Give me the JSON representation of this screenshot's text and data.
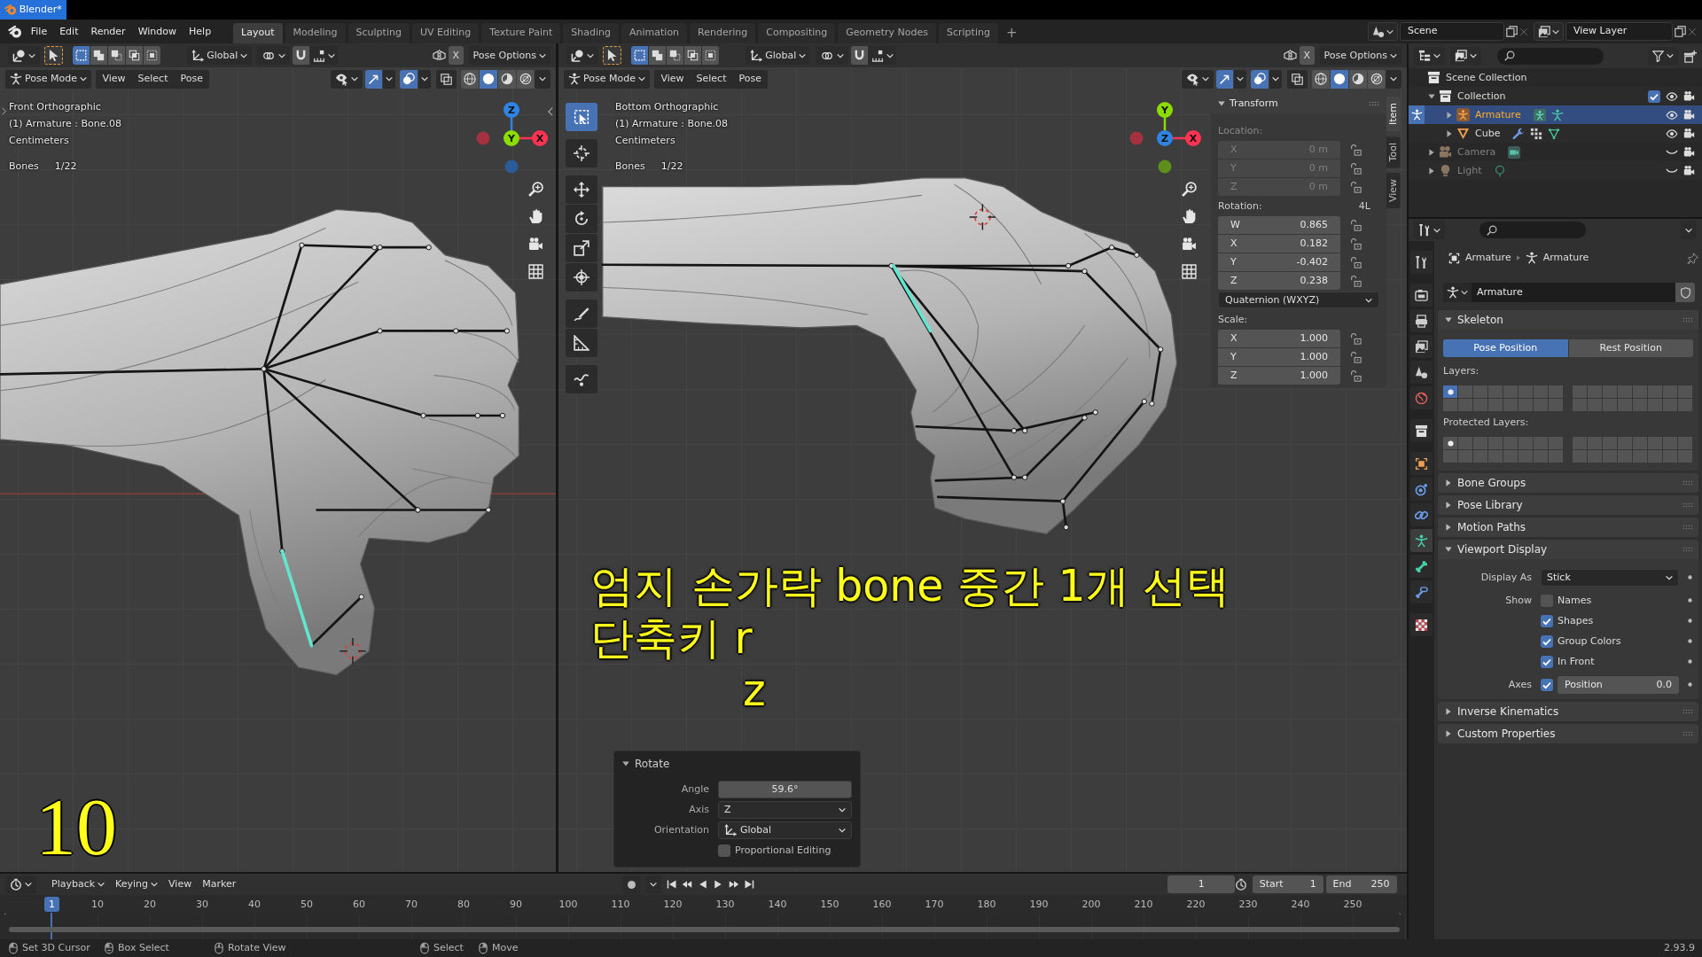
{
  "window": {
    "title": "Blender*"
  },
  "menu": [
    "File",
    "Edit",
    "Render",
    "Window",
    "Help"
  ],
  "workspaces": [
    {
      "label": "Layout",
      "selected": true
    },
    {
      "label": "Modeling",
      "selected": false
    },
    {
      "label": "Sculpting",
      "selected": false
    },
    {
      "label": "UV Editing",
      "selected": false
    },
    {
      "label": "Texture Paint",
      "selected": false
    },
    {
      "label": "Shading",
      "selected": false
    },
    {
      "label": "Animation",
      "selected": false
    },
    {
      "label": "Rendering",
      "selected": false
    },
    {
      "label": "Compositing",
      "selected": false
    },
    {
      "label": "Geometry Nodes",
      "selected": false
    },
    {
      "label": "Scripting",
      "selected": false
    }
  ],
  "add_workspace": "+",
  "scene": "Scene",
  "view_layer": "View Layer",
  "viewports": [
    {
      "kind": "side",
      "orientation": "Global",
      "mirror": "X",
      "mirror_on": false,
      "pose_options": "Pose Options",
      "mode": "Pose Mode",
      "menus": [
        "View",
        "Select",
        "Pose"
      ],
      "select_modes": [
        {
          "kind": "set",
          "selected": true
        },
        {
          "kind": "extend",
          "selected": false
        },
        {
          "kind": "subtract",
          "selected": false
        },
        {
          "kind": "invert",
          "selected": false
        },
        {
          "kind": "intersect",
          "selected": false
        }
      ],
      "gizmos_on": true,
      "overlays_on": true,
      "xray_on": false,
      "shading": [
        {
          "kind": "wireframe",
          "selected": false
        },
        {
          "kind": "solid",
          "selected": true
        },
        {
          "kind": "material",
          "selected": false
        },
        {
          "kind": "rendered",
          "selected": false
        }
      ],
      "view_name": "Front Orthographic",
      "object_info": "(1) Armature : Bone.08",
      "units": "Centimeters",
      "stats": {
        "label": "Bones",
        "value": "1/22"
      },
      "gizmo": {
        "top": {
          "label": "Z",
          "color": "#2f83e3"
        },
        "center": {
          "label": "Y",
          "color": "#8bdc00"
        },
        "right": {
          "label": "X",
          "color": "#ff3352"
        },
        "left": {
          "color": "#a3313f"
        },
        "bottom": {
          "color": "#2a5d98"
        }
      }
    },
    {
      "kind": "bottom",
      "orientation": "Global",
      "mirror": "X",
      "mirror_on": false,
      "pose_options": "Pose Options",
      "mode": "Pose Mode",
      "menus": [
        "View",
        "Select",
        "Pose"
      ],
      "select_modes": [
        {
          "kind": "set",
          "selected": true
        },
        {
          "kind": "extend",
          "selected": false
        },
        {
          "kind": "subtract",
          "selected": false
        },
        {
          "kind": "invert",
          "selected": false
        },
        {
          "kind": "intersect",
          "selected": false
        }
      ],
      "gizmos_on": true,
      "overlays_on": true,
      "xray_on": false,
      "shading": [
        {
          "kind": "wireframe",
          "selected": false
        },
        {
          "kind": "solid",
          "selected": true
        },
        {
          "kind": "material",
          "selected": false
        },
        {
          "kind": "rendered",
          "selected": false
        }
      ],
      "view_name": "Bottom Orthographic",
      "object_info": "(1) Armature : Bone.08",
      "units": "Centimeters",
      "stats": {
        "label": "Bones",
        "value": "1/22"
      },
      "gizmo": {
        "top": {
          "label": "Y",
          "color": "#8bdc00"
        },
        "center": {
          "label": "Z",
          "color": "#2f83e3"
        },
        "right": {
          "label": "X",
          "color": "#ff3352"
        },
        "left": {
          "color": "#a3313f"
        },
        "bottom": {
          "color": "#5e8f1a"
        }
      },
      "tools": [
        {
          "kind": "select",
          "selected": true
        },
        {
          "kind": "cursor",
          "selected": false
        },
        {
          "kind": "move",
          "selected": false
        },
        {
          "kind": "rotate",
          "selected": false
        },
        {
          "kind": "scale",
          "selected": false
        },
        {
          "kind": "transform",
          "selected": false
        },
        {
          "kind": "annotate",
          "selected": false
        },
        {
          "kind": "measure",
          "selected": false
        },
        {
          "kind": "relax",
          "selected": false
        }
      ],
      "sidebar": {
        "tabs": [
          {
            "label": "Item",
            "selected": true
          },
          {
            "label": "Tool",
            "selected": false
          },
          {
            "label": "View",
            "selected": false
          }
        ],
        "panel": {
          "title": "Transform",
          "expanded": true,
          "groups": [
            {
              "label": "Location:",
              "disabled": true,
              "fields": [
                {
                  "axis": "X",
                  "value": "0 m"
                },
                {
                  "axis": "Y",
                  "value": "0 m"
                },
                {
                  "axis": "Z",
                  "value": "0 m"
                }
              ]
            },
            {
              "label": "Rotation:",
              "badge": "4L",
              "disabled": false,
              "fields": [
                {
                  "axis": "W",
                  "value": "0.865"
                },
                {
                  "axis": "X",
                  "value": "0.182"
                },
                {
                  "axis": "Y",
                  "value": "-0.402"
                },
                {
                  "axis": "Z",
                  "value": "0.238"
                }
              ],
              "mode": "Quaternion (WXYZ)"
            },
            {
              "label": "Scale:",
              "disabled": false,
              "fields": [
                {
                  "axis": "X",
                  "value": "1.000"
                },
                {
                  "axis": "Y",
                  "value": "1.000"
                },
                {
                  "axis": "Z",
                  "value": "1.000"
                }
              ]
            }
          ]
        }
      },
      "operator": {
        "title": "Rotate",
        "expanded": true,
        "rows": [
          {
            "kind": "number",
            "label": "Angle",
            "value": "59.6°"
          },
          {
            "kind": "dropdown",
            "label": "Axis",
            "value": "Z"
          },
          {
            "kind": "orientation",
            "label": "Orientation",
            "value": "Global"
          },
          {
            "kind": "checkbox",
            "label": "Proportional Editing",
            "checked": false
          }
        ]
      }
    }
  ],
  "caption": {
    "lines": [
      "엄지 손가락 bone 중간 1개 선택",
      "단축키 r"
    ],
    "key": "z"
  },
  "step_number": "10",
  "timeline": {
    "menus": [
      {
        "label": "Playback",
        "dropdown": true
      },
      {
        "label": "Keying",
        "dropdown": true
      },
      {
        "label": "View",
        "dropdown": false
      },
      {
        "label": "Marker",
        "dropdown": false
      }
    ],
    "auto_key_on": false,
    "frame": "1",
    "start": {
      "label": "Start",
      "value": "1"
    },
    "end": {
      "label": "End",
      "value": "250"
    },
    "playhead": "1",
    "ruler": [
      "10",
      "20",
      "30",
      "40",
      "50",
      "60",
      "70",
      "80",
      "90",
      "100",
      "110",
      "120",
      "130",
      "140",
      "150",
      "160",
      "170",
      "180",
      "190",
      "200",
      "210",
      "220",
      "230",
      "240",
      "250"
    ]
  },
  "outliner": {
    "root": {
      "name": "Scene Collection",
      "children": [
        {
          "name": "Collection",
          "kind": "collection",
          "expanded": true,
          "included": true,
          "selected": false,
          "visible": true,
          "children": [
            {
              "name": "Armature",
              "kind": "armature",
              "expanded": false,
              "selected": true,
              "visible": true
            },
            {
              "name": "Cube",
              "kind": "mesh",
              "expanded": false,
              "selected": false,
              "visible": true
            }
          ]
        },
        {
          "name": "Camera",
          "kind": "camera",
          "expanded": false,
          "selected": false,
          "visible": false
        },
        {
          "name": "Light",
          "kind": "light",
          "expanded": false,
          "selected": false,
          "visible": false
        }
      ]
    }
  },
  "properties": {
    "tabs": [
      {
        "kind": "tool",
        "selected": false
      },
      {
        "kind": "render",
        "selected": false
      },
      {
        "kind": "output",
        "selected": false
      },
      {
        "kind": "view-layer",
        "selected": false
      },
      {
        "kind": "scene",
        "selected": false
      },
      {
        "kind": "world",
        "selected": false
      },
      {
        "kind": "collection",
        "selected": false
      },
      {
        "kind": "object",
        "selected": false
      },
      {
        "kind": "physics",
        "selected": false
      },
      {
        "kind": "constraints",
        "selected": false
      },
      {
        "kind": "armature",
        "selected": true
      },
      {
        "kind": "bone",
        "selected": false
      },
      {
        "kind": "bone-constraints",
        "selected": false
      },
      {
        "kind": "texture",
        "selected": false
      }
    ],
    "breadcrumb": [
      "Armature",
      "Armature"
    ],
    "datablock": "Armature",
    "panels": [
      {
        "kind": "skeleton",
        "title": "Skeleton",
        "expanded": true,
        "positions": [
          {
            "label": "Pose Position",
            "selected": true
          },
          {
            "label": "Rest Position",
            "selected": false
          }
        ],
        "layers": {
          "label": "Layers:",
          "cells": [
            {
              "selected": true,
              "used": true
            },
            {
              "selected": false,
              "used": false
            },
            {
              "selected": false,
              "used": false
            },
            {
              "selected": false,
              "used": false
            },
            {
              "selected": false,
              "used": false
            },
            {
              "selected": false,
              "used": false
            },
            {
              "selected": false,
              "used": false
            },
            {
              "selected": false,
              "used": false
            },
            {
              "selected": false,
              "used": false
            },
            {
              "selected": false,
              "used": false
            },
            {
              "selected": false,
              "used": false
            },
            {
              "selected": false,
              "used": false
            },
            {
              "selected": false,
              "used": false
            },
            {
              "selected": false,
              "used": false
            },
            {
              "selected": false,
              "used": false
            },
            {
              "selected": false,
              "used": false
            },
            {
              "selected": false,
              "used": false
            },
            {
              "selected": false,
              "used": false
            },
            {
              "selected": false,
              "used": false
            },
            {
              "selected": false,
              "used": false
            },
            {
              "selected": false,
              "used": false
            },
            {
              "selected": false,
              "used": false
            },
            {
              "selected": false,
              "used": false
            },
            {
              "selected": false,
              "used": false
            },
            {
              "selected": false,
              "used": false
            },
            {
              "selected": false,
              "used": false
            },
            {
              "selected": false,
              "used": false
            },
            {
              "selected": false,
              "used": false
            },
            {
              "selected": false,
              "used": false
            },
            {
              "selected": false,
              "used": false
            },
            {
              "selected": false,
              "used": false
            },
            {
              "selected": false,
              "used": false
            }
          ]
        },
        "protected": {
          "label": "Protected Layers:",
          "cells": [
            {
              "selected": false,
              "used": true
            },
            {
              "selected": false,
              "used": false
            },
            {
              "selected": false,
              "used": false
            },
            {
              "selected": false,
              "used": false
            },
            {
              "selected": false,
              "used": false
            },
            {
              "selected": false,
              "used": false
            },
            {
              "selected": false,
              "used": false
            },
            {
              "selected": false,
              "used": false
            },
            {
              "selected": false,
              "used": false
            },
            {
              "selected": false,
              "used": false
            },
            {
              "selected": false,
              "used": false
            },
            {
              "selected": false,
              "used": false
            },
            {
              "selected": false,
              "used": false
            },
            {
              "selected": false,
              "used": false
            },
            {
              "selected": false,
              "used": false
            },
            {
              "selected": false,
              "used": false
            },
            {
              "selected": false,
              "used": false
            },
            {
              "selected": false,
              "used": false
            },
            {
              "selected": false,
              "used": false
            },
            {
              "selected": false,
              "used": false
            },
            {
              "selected": false,
              "used": false
            },
            {
              "selected": false,
              "used": false
            },
            {
              "selected": false,
              "used": false
            },
            {
              "selected": false,
              "used": false
            },
            {
              "selected": false,
              "used": false
            },
            {
              "selected": false,
              "used": false
            },
            {
              "selected": false,
              "used": false
            },
            {
              "selected": false,
              "used": false
            },
            {
              "selected": false,
              "used": false
            },
            {
              "selected": false,
              "used": false
            },
            {
              "selected": false,
              "used": false
            },
            {
              "selected": false,
              "used": false
            }
          ]
        }
      },
      {
        "title": "Bone Groups",
        "expanded": false
      },
      {
        "title": "Pose Library",
        "expanded": false
      },
      {
        "title": "Motion Paths",
        "expanded": false
      },
      {
        "kind": "display",
        "title": "Viewport Display",
        "expanded": true,
        "display_as": {
          "label": "Display As",
          "value": "Stick"
        },
        "show": {
          "label": "Show",
          "options": [
            {
              "label": "Names",
              "checked": false
            },
            {
              "label": "Shapes",
              "checked": true
            },
            {
              "label": "Group Colors",
              "checked": true
            },
            {
              "label": "In Front",
              "checked": true
            }
          ]
        },
        "axes": {
          "label": "Axes",
          "checked": true,
          "field": "Position",
          "value": "0.0"
        }
      },
      {
        "title": "Inverse Kinematics",
        "expanded": false
      },
      {
        "title": "Custom Properties",
        "expanded": false
      }
    ]
  },
  "status_bar": {
    "items": [
      {
        "kind": "left",
        "label": "Set 3D Cursor"
      },
      {
        "kind": "drag",
        "label": "Box Select"
      },
      {
        "kind": "middle",
        "label": "Rotate View"
      },
      {
        "kind": "left",
        "label": "Select"
      },
      {
        "kind": "right",
        "label": "Move"
      }
    ],
    "version": "2.93.9"
  }
}
